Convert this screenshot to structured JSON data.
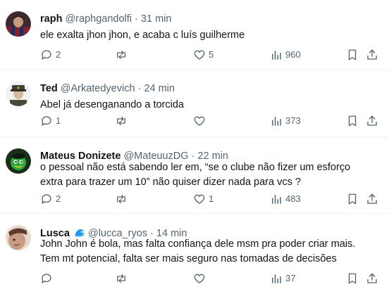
{
  "tweets": [
    {
      "name": "raph",
      "handle": "@raphgandolfi",
      "sep": "·",
      "time": "31 min",
      "text": "ele exalta jhon jhon, e acaba c luís guilherme",
      "replies": "2",
      "reposts": "",
      "likes": "5",
      "views": "960"
    },
    {
      "name": "Ted",
      "handle": "@Arkatedyevich",
      "sep": "·",
      "time": "24 min",
      "text": "Abel já desenganando a torcida",
      "replies": "1",
      "reposts": "",
      "likes": "",
      "views": "373"
    },
    {
      "name": "Mateus Donizete",
      "handle": "@MateuuzDG",
      "sep": "·",
      "time": "22 min",
      "text": "o pessoal não está sabendo ler em, “se o clube não fizer um esforço extra para trazer um 10” não quiser dizer nada para vcs ?",
      "replies": "2",
      "reposts": "",
      "likes": "1",
      "views": "483"
    },
    {
      "name": "Lusca",
      "handle": "@lucca_ryos",
      "sep": "·",
      "time": "14 min",
      "text": "John John é bola, mas falta confiança dele msm pra poder criar mais. Tem mt potencial, falta ser mais seguro nas tomadas de decisões",
      "replies": "",
      "reposts": "",
      "likes": "",
      "views": "37"
    }
  ],
  "colors": {
    "text": "#0f1419",
    "secondary": "#536471",
    "divider": "#eff3f4",
    "wave_emoji": "#1d9bf0"
  },
  "icons": [
    "reply-icon",
    "repost-icon",
    "like-icon",
    "views-icon",
    "bookmark-icon",
    "share-icon",
    "wave-emoji-icon"
  ]
}
